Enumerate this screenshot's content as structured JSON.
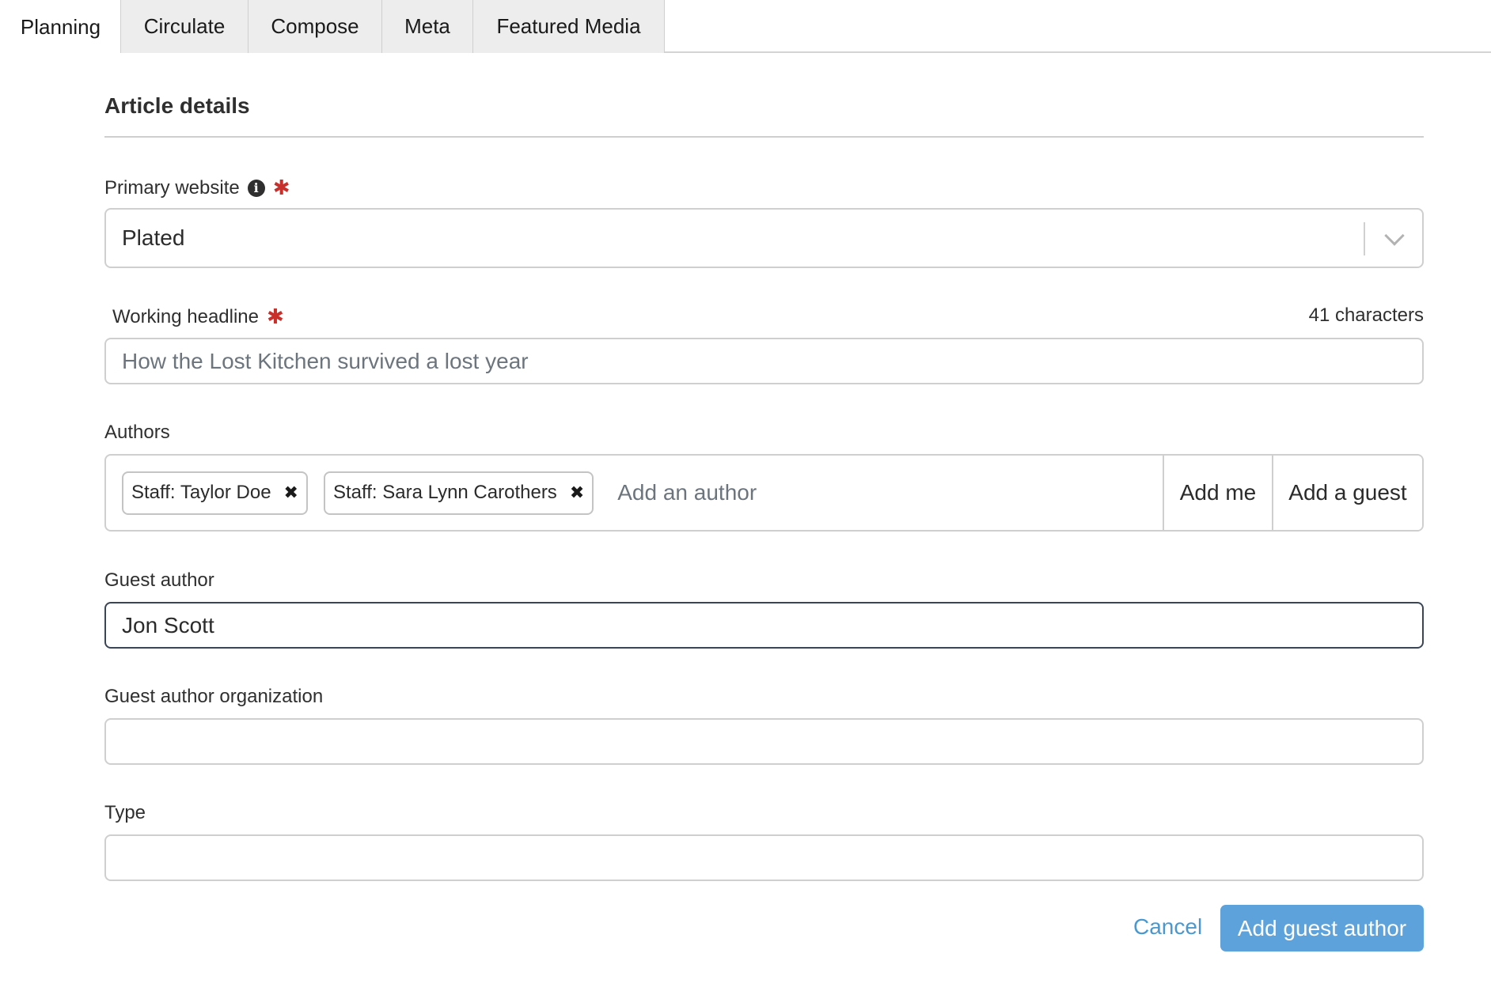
{
  "tabs": [
    {
      "label": "Planning",
      "active": true
    },
    {
      "label": "Circulate",
      "active": false
    },
    {
      "label": "Compose",
      "active": false
    },
    {
      "label": "Meta",
      "active": false
    },
    {
      "label": "Featured Media",
      "active": false
    }
  ],
  "section": {
    "title": "Article details"
  },
  "primary_website": {
    "label": "Primary website",
    "required_mark": "✱",
    "info_icon": "info-icon",
    "value": "Plated"
  },
  "headline": {
    "label": "Working headline",
    "required_mark": "✱",
    "counter": "41 characters",
    "placeholder": "How the Lost Kitchen survived a lost year",
    "value": ""
  },
  "authors": {
    "label": "Authors",
    "chips": [
      {
        "label": "Staff: Taylor Doe",
        "remove_icon": "close-icon"
      },
      {
        "label": "Staff: Sara Lynn Carothers",
        "remove_icon": "close-icon"
      }
    ],
    "search_placeholder": "Add an author",
    "add_me_label": "Add me",
    "add_guest_label": "Add a guest"
  },
  "guest_author": {
    "label": "Guest author",
    "value": "Jon Scott"
  },
  "guest_author_org": {
    "label": "Guest author organization",
    "value": ""
  },
  "type": {
    "label": "Type",
    "value": ""
  },
  "actions": {
    "cancel_label": "Cancel",
    "submit_label": "Add guest author"
  },
  "colors": {
    "required": "#c9302c",
    "link": "#4a98d0",
    "primary_button": "#5da2da",
    "focus_border": "#3a4555"
  }
}
